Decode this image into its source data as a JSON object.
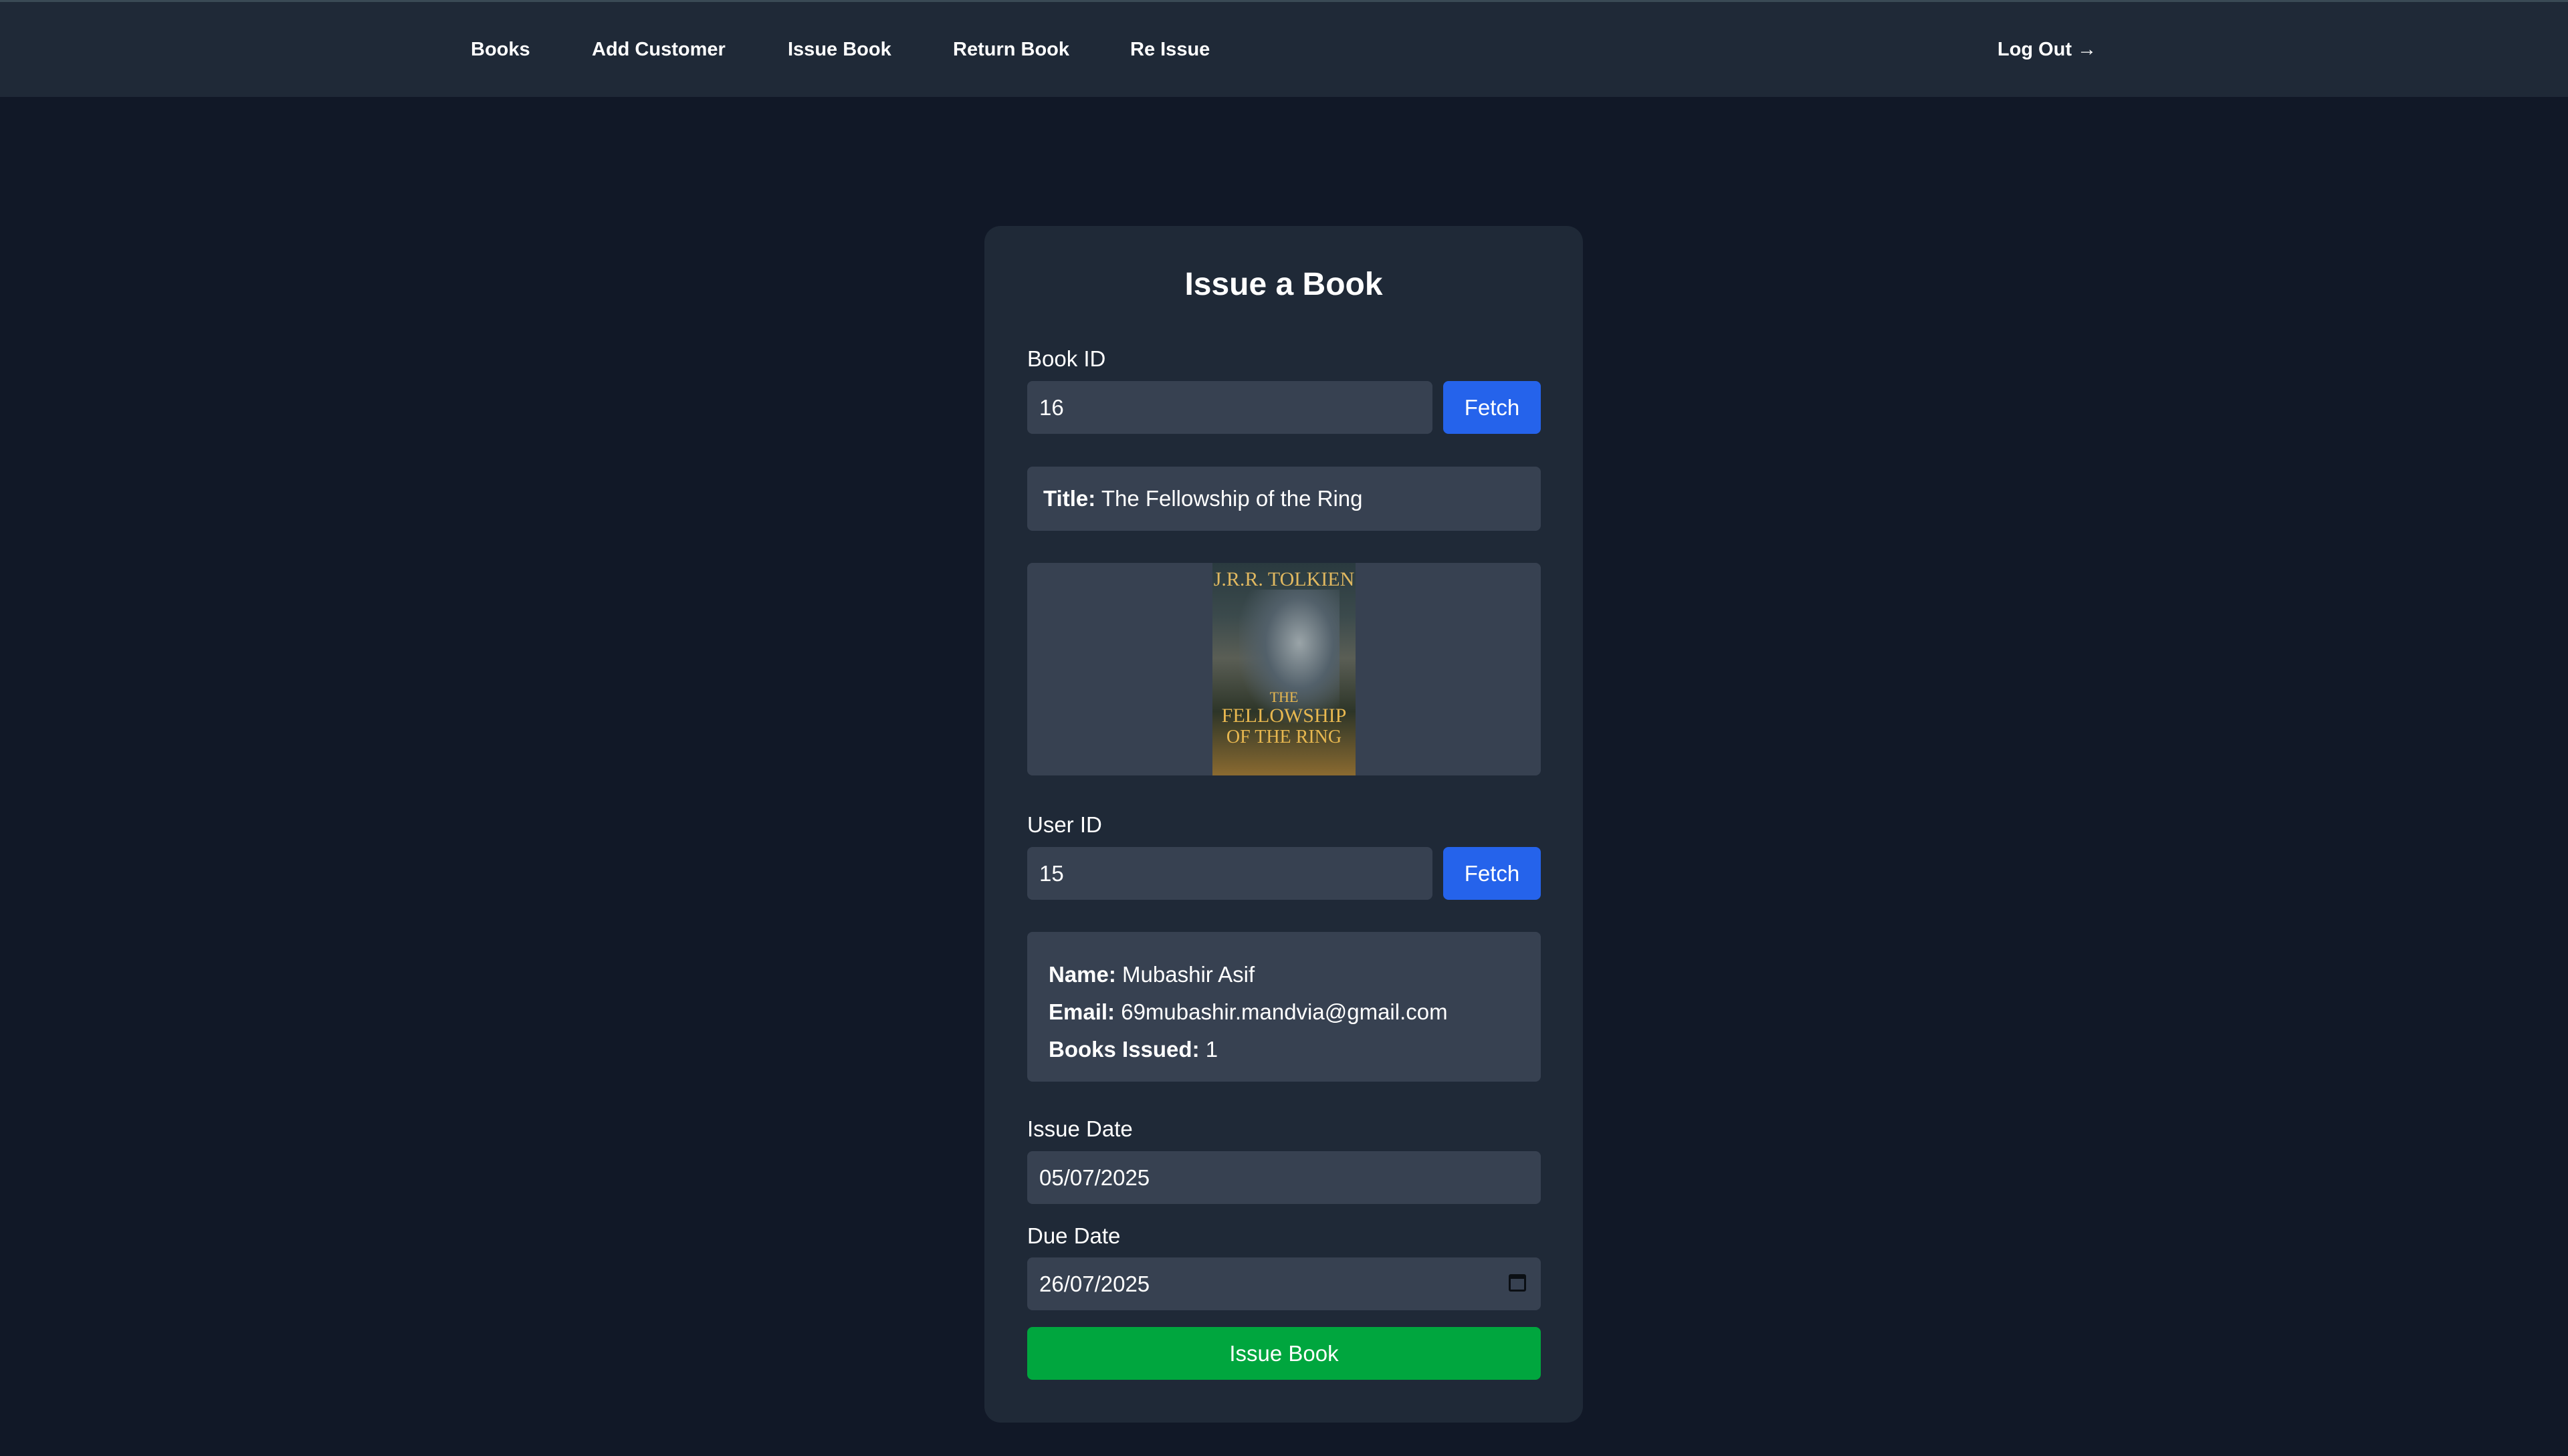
{
  "nav": {
    "books": "Books",
    "add_customer": "Add Customer",
    "issue_book": "Issue Book",
    "return_book": "Return Book",
    "re_issue": "Re Issue",
    "log_out": "Log Out",
    "log_out_icon": "→"
  },
  "form": {
    "title": "Issue a Book",
    "book_id_label": "Book ID",
    "book_id_value": "16",
    "fetch_label": "Fetch",
    "book_title_key": "Title:",
    "book_title_value": "The Fellowship of the Ring",
    "cover": {
      "author": "J.R.R. TOLKIEN",
      "title_line1": "THE",
      "title_line2": "FELLOWSHIP",
      "title_line3": "OF THE RING"
    },
    "user_id_label": "User ID",
    "user_id_value": "15",
    "user_fetch_label": "Fetch",
    "name_key": "Name:",
    "name_value": "Mubashir Asif",
    "email_key": "Email:",
    "email_value": "69mubashir.mandvia@gmail.com",
    "books_issued_key": "Books Issued:",
    "books_issued_value": "1",
    "issue_date_label": "Issue Date",
    "issue_date_value": "05/07/2025",
    "due_date_label": "Due Date",
    "due_date_value": "26/07/2025",
    "submit_label": "Issue Book"
  },
  "colors": {
    "background": "#111827",
    "panel": "#1f2937",
    "input": "#374151",
    "primary": "#2563eb",
    "success": "#00a63e"
  }
}
